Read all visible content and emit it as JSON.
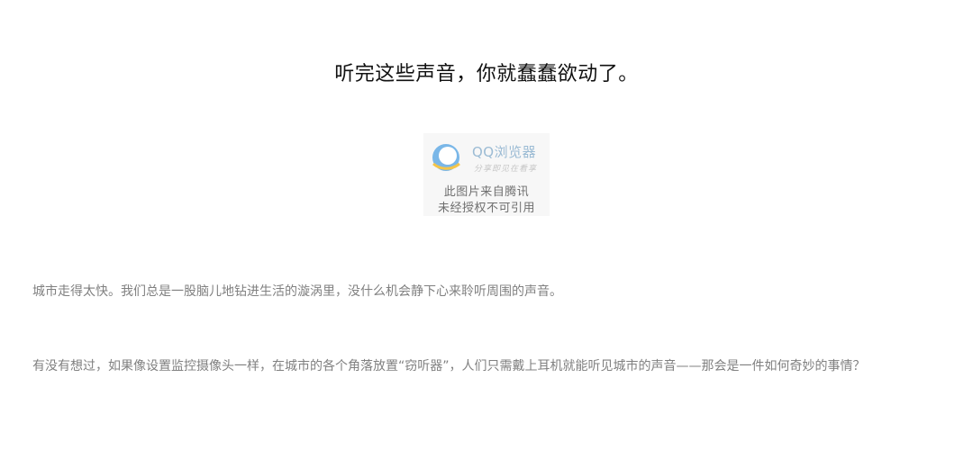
{
  "article": {
    "title": "听完这些声音，你就蠢蠢欲动了。",
    "image_placeholder": {
      "brand": "QQ浏览器",
      "slogan": "分享即见在看享",
      "line1": "此图片来自腾讯",
      "line2": "未经授权不可引用"
    },
    "paragraphs": [
      "城市走得太快。我们总是一股脑儿地钻进生活的漩涡里，没什么机会静下心来聆听周围的声音。",
      "有没有想过，如果像设置监控摄像头一样，在城市的各个角落放置“窃听器”，人们只需戴上耳机就能听见城市的声音——那会是一件如何奇妙的事情？"
    ]
  },
  "colors": {
    "title": "#111111",
    "body_text": "#808080",
    "logo_accent": "#7ab7e8"
  }
}
